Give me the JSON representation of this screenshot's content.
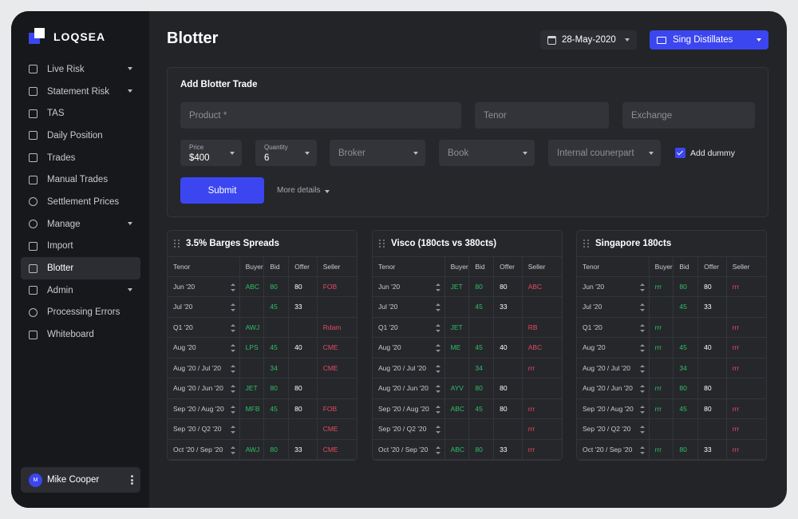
{
  "app": {
    "name": "LOQSEA"
  },
  "sidebar": {
    "items": [
      {
        "label": "Live Risk",
        "icon": "grid-icon",
        "caret": true
      },
      {
        "label": "Statement Risk",
        "icon": "grid-icon",
        "caret": true
      },
      {
        "label": "TAS",
        "icon": "grid-icon",
        "caret": false
      },
      {
        "label": "Daily Position",
        "icon": "calendar-icon",
        "caret": false
      },
      {
        "label": "Trades",
        "icon": "candles-icon",
        "caret": false
      },
      {
        "label": "Manual Trades",
        "icon": "sliders-icon",
        "caret": false
      },
      {
        "label": "Settlement Prices",
        "icon": "coin-icon",
        "caret": false
      },
      {
        "label": "Manage",
        "icon": "clock-icon",
        "caret": true
      },
      {
        "label": "Import",
        "icon": "import-icon",
        "caret": false
      },
      {
        "label": "Blotter",
        "icon": "laptop-icon",
        "caret": false,
        "active": true
      },
      {
        "label": "Admin",
        "icon": "hexagon-icon",
        "caret": true
      },
      {
        "label": "Processing Errors",
        "icon": "alert-icon",
        "caret": false
      },
      {
        "label": "Whiteboard",
        "icon": "document-icon",
        "caret": false
      }
    ]
  },
  "user": {
    "initial": "M",
    "name": "Mike Cooper"
  },
  "header": {
    "title": "Blotter",
    "date": "28-May-2020",
    "book": "Sing Distillates"
  },
  "form": {
    "title": "Add Blotter Trade",
    "product_placeholder": "Product *",
    "tenor_placeholder": "Tenor",
    "exchange_placeholder": "Exchange",
    "price_label": "Price",
    "price_value": "$400",
    "quantity_label": "Quantity",
    "quantity_value": "6",
    "broker_placeholder": "Broker",
    "book_placeholder": "Book",
    "counterpart_placeholder": "Internal counerpart",
    "dummy_label": "Add dummy",
    "dummy_checked": true,
    "submit_label": "Submit",
    "more_label": "More details"
  },
  "tables": [
    {
      "title": "3.5% Barges Spreads",
      "columns": [
        "Tenor",
        "Buyer",
        "Bid",
        "Offer",
        "Seller"
      ],
      "rows": [
        [
          "Jun '20",
          "ABC",
          "80",
          "80",
          "FOB"
        ],
        [
          "Jul '20",
          "",
          "45",
          "33",
          ""
        ],
        [
          "Q1 '20",
          "AWJ",
          "",
          "",
          "Rdam"
        ],
        [
          "Aug '20",
          "LPS",
          "45",
          "40",
          "CME"
        ],
        [
          "Aug '20 / Jul '20",
          "",
          "34",
          "",
          "CME"
        ],
        [
          "Aug '20 / Jun '20",
          "JET",
          "80",
          "80",
          ""
        ],
        [
          "Sep '20 / Aug '20",
          "MFB",
          "45",
          "80",
          "FOB"
        ],
        [
          "Sep '20 / Q2 '20",
          "",
          "",
          "",
          "CME"
        ],
        [
          "Oct '20 / Sep '20",
          "AWJ",
          "80",
          "33",
          "CME"
        ]
      ]
    },
    {
      "title": "Visco (180cts vs 380cts)",
      "columns": [
        "Tenor",
        "Buyer",
        "Bid",
        "Offer",
        "Seller"
      ],
      "rows": [
        [
          "Jun '20",
          "JET",
          "80",
          "80",
          "ABC"
        ],
        [
          "Jul '20",
          "",
          "45",
          "33",
          ""
        ],
        [
          "Q1 '20",
          "JET",
          "",
          "",
          "RB"
        ],
        [
          "Aug '20",
          "ME",
          "45",
          "40",
          "ABC"
        ],
        [
          "Aug '20 / Jul '20",
          "",
          "34",
          "",
          "rrr"
        ],
        [
          "Aug '20 / Jun '20",
          "AYV",
          "80",
          "80",
          ""
        ],
        [
          "Sep '20 / Aug '20",
          "ABC",
          "45",
          "80",
          "rrr"
        ],
        [
          "Sep '20 / Q2 '20",
          "",
          "",
          "",
          "rrr"
        ],
        [
          "Oct '20 / Sep '20",
          "ABC",
          "80",
          "33",
          "rrr"
        ]
      ]
    },
    {
      "title": "Singapore 180cts",
      "columns": [
        "Tenor",
        "Buyer",
        "Bid",
        "Offer",
        "Seller"
      ],
      "rows": [
        [
          "Jun '20",
          "rrr",
          "80",
          "80",
          "rrr"
        ],
        [
          "Jul '20",
          "",
          "45",
          "33",
          ""
        ],
        [
          "Q1 '20",
          "rrr",
          "",
          "",
          "rrr"
        ],
        [
          "Aug '20",
          "rrr",
          "45",
          "40",
          "rrr"
        ],
        [
          "Aug '20 / Jul '20",
          "",
          "34",
          "",
          "rrr"
        ],
        [
          "Aug '20 / Jun '20",
          "rrr",
          "80",
          "80",
          ""
        ],
        [
          "Sep '20 / Aug '20",
          "rrr",
          "45",
          "80",
          "rrr"
        ],
        [
          "Sep '20 / Q2 '20",
          "",
          "",
          "",
          "rrr"
        ],
        [
          "Oct '20 / Sep '20",
          "rrr",
          "80",
          "33",
          "rrr"
        ]
      ]
    }
  ],
  "colors": {
    "accent": "#3b46f0",
    "buy": "#2fbf63",
    "sell": "#e84a5f",
    "background": "#222428",
    "sidebar": "#17181b"
  }
}
